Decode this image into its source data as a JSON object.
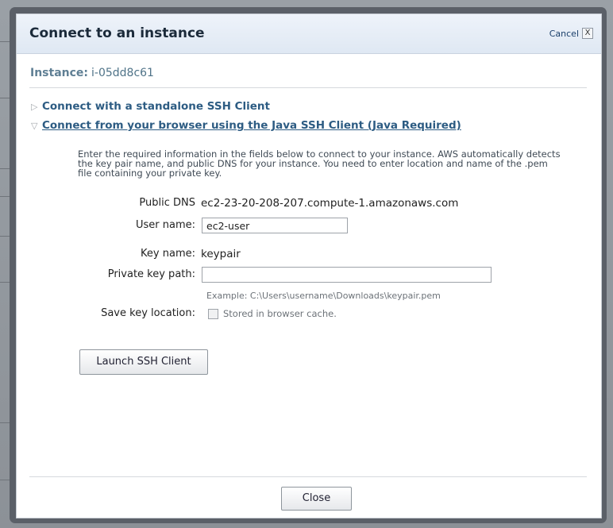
{
  "dialog": {
    "title": "Connect to an instance",
    "cancel_label": "Cancel",
    "cancel_icon": "X",
    "instance_label": "Instance:",
    "instance_id": "i-05dd8c61"
  },
  "sections": [
    {
      "label": "Connect with a standalone SSH Client",
      "expanded": false
    },
    {
      "label": "Connect from your browser using the Java SSH Client (Java Required)",
      "expanded": true
    }
  ],
  "java_client": {
    "intro": "Enter the required information in the fields below to connect to your instance. AWS automatically detects the key pair name, and public DNS for your instance. You need to enter location and name of the .pem file containing your private key.",
    "public_dns_label": "Public DNS",
    "public_dns_value": "ec2-23-20-208-207.compute-1.amazonaws.com",
    "user_name_label": "User name:",
    "user_name_value": "ec2-user",
    "key_name_label": "Key name:",
    "key_name_value": "keypair",
    "private_key_label": "Private key path:",
    "private_key_value": "",
    "private_key_hint": "Example: C:\\Users\\username\\Downloads\\keypair.pem",
    "save_key_label": "Save key location:",
    "save_key_checkbox_label": "Stored in browser cache.",
    "save_key_checked": false,
    "launch_button": "Launch SSH Client"
  },
  "footer": {
    "close_button": "Close"
  },
  "colors": {
    "accent_link": "#2d5c83",
    "instance_label": "#5f7f94",
    "header_bg": "#e4ecf6",
    "dialog_frame": "#5b6068"
  }
}
